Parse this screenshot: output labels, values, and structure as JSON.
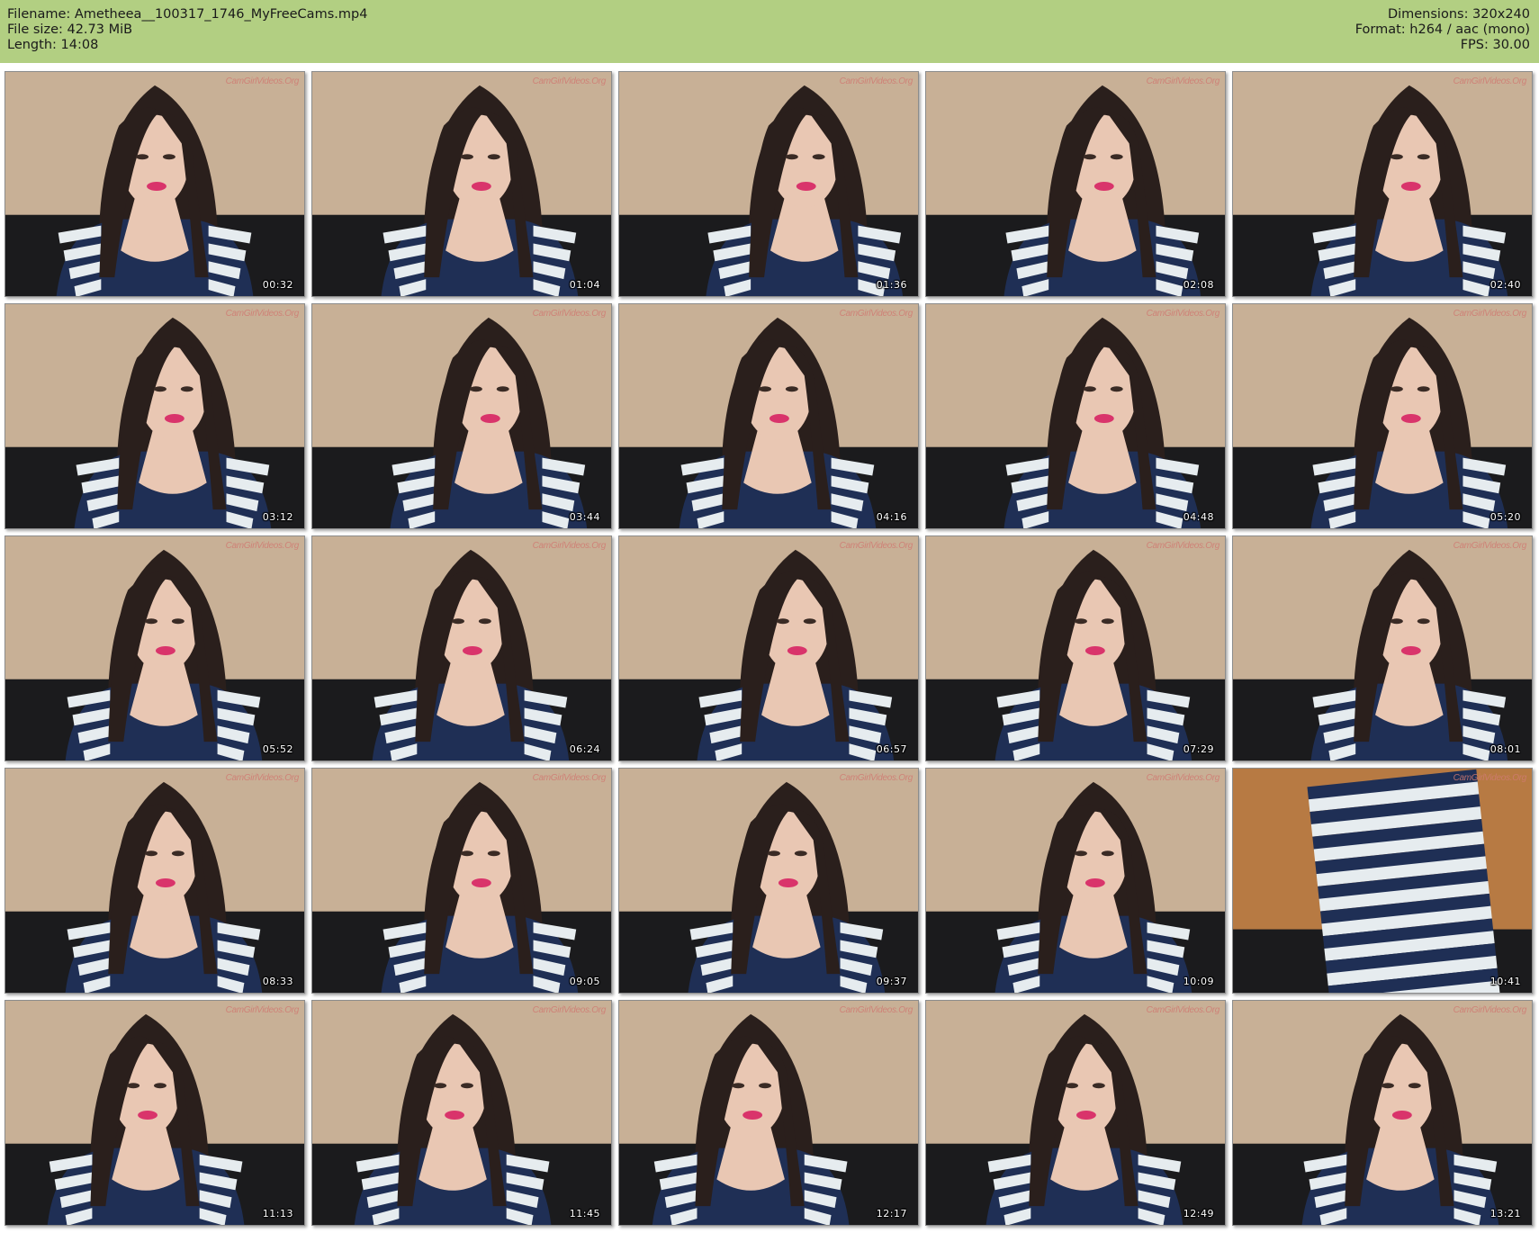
{
  "header": {
    "filename_line": "Filename: Ametheea__100317_1746_MyFreeCams.mp4",
    "filesize_line": "File size: 42.73 MiB",
    "length_line": "Length: 14:08",
    "dimensions_line": "Dimensions: 320x240",
    "format_line": "Format: h264 / aac (mono)",
    "fps_line": "FPS: 30.00"
  },
  "colors": {
    "header_background": "#b2cf82",
    "wall": "#c8b096",
    "couch": "#1b1b1d",
    "hair": "#2a1f1c",
    "skin": "#e9c7b3",
    "shirt_navy": "#1f2f55",
    "shirt_white": "#e6ecef",
    "lips": "#d9346b",
    "watermark": "#d07a72"
  },
  "watermark_text": "CamGirlVideos.Org",
  "thumbnails": [
    {
      "time": "00:32"
    },
    {
      "time": "01:04"
    },
    {
      "time": "01:36"
    },
    {
      "time": "02:08"
    },
    {
      "time": "02:40"
    },
    {
      "time": "03:12"
    },
    {
      "time": "03:44"
    },
    {
      "time": "04:16"
    },
    {
      "time": "04:48"
    },
    {
      "time": "05:20"
    },
    {
      "time": "05:52"
    },
    {
      "time": "06:24"
    },
    {
      "time": "06:57"
    },
    {
      "time": "07:29"
    },
    {
      "time": "08:01"
    },
    {
      "time": "08:33"
    },
    {
      "time": "09:05"
    },
    {
      "time": "09:37"
    },
    {
      "time": "10:09"
    },
    {
      "time": "10:41"
    },
    {
      "time": "11:13"
    },
    {
      "time": "11:45"
    },
    {
      "time": "12:17"
    },
    {
      "time": "12:49"
    },
    {
      "time": "13:21"
    }
  ]
}
